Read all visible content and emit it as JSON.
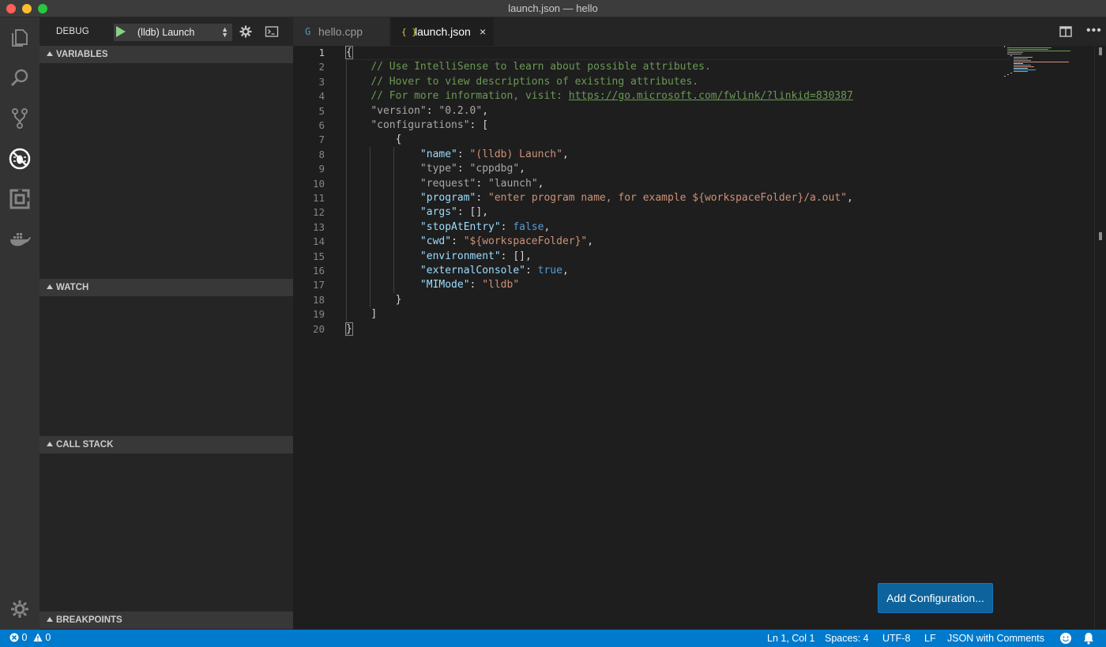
{
  "window": {
    "title": "launch.json — hello"
  },
  "sidebar": {
    "title": "DEBUG",
    "launch_config": "(lldb) Launch",
    "sections": [
      {
        "label": "VARIABLES"
      },
      {
        "label": "WATCH"
      },
      {
        "label": "CALL STACK"
      },
      {
        "label": "BREAKPOINTS"
      }
    ]
  },
  "tabs": [
    {
      "label": "hello.cpp",
      "icon": "cpp-file-icon",
      "icon_glyph": "G",
      "active": false
    },
    {
      "label": "launch.json",
      "icon": "json-file-icon",
      "icon_glyph": "{ }",
      "active": true,
      "close": "×"
    }
  ],
  "editor": {
    "line_numbers": [
      "1",
      "2",
      "3",
      "4",
      "5",
      "6",
      "7",
      "8",
      "9",
      "10",
      "11",
      "12",
      "13",
      "14",
      "15",
      "16",
      "17",
      "18",
      "19",
      "20"
    ],
    "code": {
      "l1": "{",
      "l2": "// Use IntelliSense to learn about possible attributes.",
      "l3": "// Hover to view descriptions of existing attributes.",
      "l4_prefix": "// For more information, visit: ",
      "l4_link": "https://go.microsoft.com/fwlink/?linkid=830387",
      "l5_key": "\"version\"",
      "l5_val": "\"0.2.0\"",
      "l6_key": "\"configurations\"",
      "l6_rest": ": [",
      "l7": "{",
      "l8_key": "\"name\"",
      "l8_val": "\"(lldb) Launch\"",
      "l9_key": "\"type\"",
      "l9_val": "\"cppdbg\"",
      "l10_key": "\"request\"",
      "l10_val": "\"launch\"",
      "l11_key": "\"program\"",
      "l11_val": "\"enter program name, for example ${workspaceFolder}/a.out\"",
      "l12_key": "\"args\"",
      "l12_val": "[]",
      "l13_key": "\"stopAtEntry\"",
      "l13_val": "false",
      "l14_key": "\"cwd\"",
      "l14_val": "\"${workspaceFolder}\"",
      "l15_key": "\"environment\"",
      "l15_val": "[]",
      "l16_key": "\"externalConsole\"",
      "l16_val": "true",
      "l17_key": "\"MIMode\"",
      "l17_val": "\"lldb\"",
      "l18": "}",
      "l19": "]",
      "l20": "}"
    },
    "add_configuration_label": "Add Configuration..."
  },
  "statusbar": {
    "errors": "0",
    "warnings": "0",
    "position": "Ln 1, Col 1",
    "spaces": "Spaces: 4",
    "encoding": "UTF-8",
    "eol": "LF",
    "language": "JSON with Comments"
  },
  "colors": {
    "accent": "#007acc",
    "button": "#0e639c",
    "comment": "#6a9955",
    "key": "#9cdcfe",
    "string": "#ce9178",
    "boolean": "#569cd6"
  }
}
